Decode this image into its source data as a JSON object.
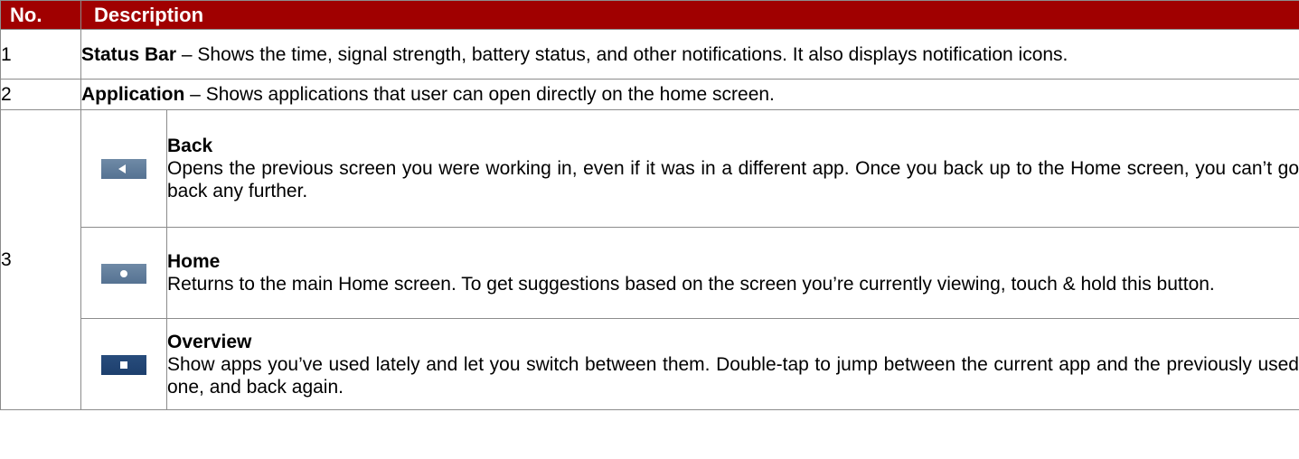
{
  "header": {
    "col_no": "No.",
    "col_desc": "Description"
  },
  "rows": [
    {
      "num": "1",
      "title": "Status Bar",
      "text": " – Shows the time, signal strength, battery status, and other notifications. It also displays notification icons."
    },
    {
      "num": "2",
      "title": "Application",
      "text": " – Shows applications that user can open directly on the home screen."
    }
  ],
  "nav_row": {
    "num": "3",
    "items": [
      {
        "icon": "back-icon",
        "title": "Back",
        "text": "Opens the previous screen you were working in, even if it was in a different app. Once you back up to the Home screen, you can’t go back any further."
      },
      {
        "icon": "home-icon",
        "title": "Home",
        "text": "Returns to the main Home screen. To get suggestions based on the screen you’re currently viewing, touch & hold this button."
      },
      {
        "icon": "overview-icon",
        "title": "Overview",
        "text": "Show apps you’ve used lately and let you switch between them. Double-tap to jump between the current app and the previously used one, and back again."
      }
    ]
  },
  "colors": {
    "header_bg": "#a00000",
    "header_text": "#ffffff",
    "border": "#8c8c8c",
    "nav_button": "#5f7c9c",
    "nav_button_dark": "#244879"
  }
}
